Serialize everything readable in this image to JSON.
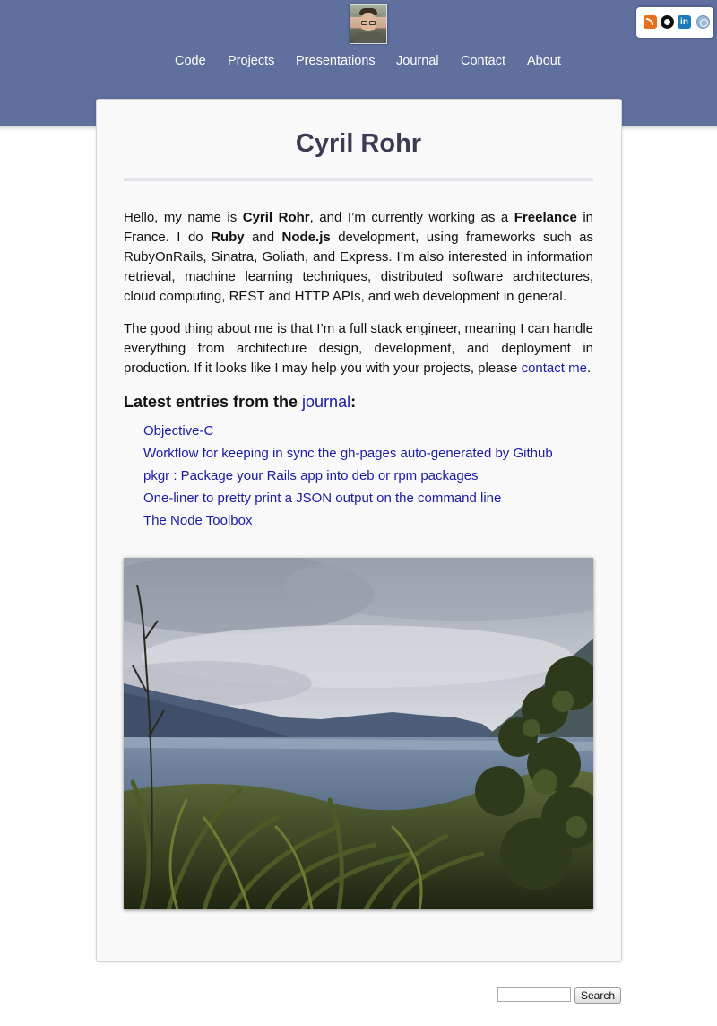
{
  "header": {
    "nav": [
      "Code",
      "Projects",
      "Presentations",
      "Journal",
      "Contact",
      "About"
    ],
    "social_icons": [
      "rss-icon",
      "github-icon",
      "linkedin-icon",
      "web-icon"
    ],
    "linkedin_glyph": "in",
    "colors": {
      "header_bg": "#5f6f9e",
      "link": "#1a1aa6",
      "title": "#3b3b53"
    }
  },
  "main": {
    "title": "Cyril Rohr",
    "intro": {
      "t1": "Hello, my name is ",
      "name": "Cyril Rohr",
      "t2": ", and I’m currently working as a ",
      "freelance": "Freelance",
      "t3": " in France. I do ",
      "ruby": "Ruby",
      "t4": " and ",
      "node": "Node.js",
      "t5": " development, using frameworks such as RubyOnRails, Sinatra, Goliath, and Express. I’m also interested in information retrieval, machine learning techniques, distributed software architectures, cloud computing, REST and HTTP APIs, and web development in general."
    },
    "second": {
      "t1": "The good thing about me is that I’m a full stack engineer, meaning I can handle everything from architecture design, development, and deployment in production. If it looks like I may help you with your projects, please ",
      "link": "contact me",
      "t2": "."
    },
    "latest": {
      "prefix": "Latest entries from the ",
      "link": "journal",
      "suffix": ":",
      "entries": [
        "Objective-C",
        "Workflow for keeping in sync the gh-pages auto-generated by Github",
        "pkgr : Package your Rails app into deb or rpm packages",
        "One-liner to pretty print a JSON output on the command line",
        "The Node Toolbox"
      ]
    }
  },
  "footer": {
    "search_placeholder": "",
    "search_button": "Search"
  }
}
